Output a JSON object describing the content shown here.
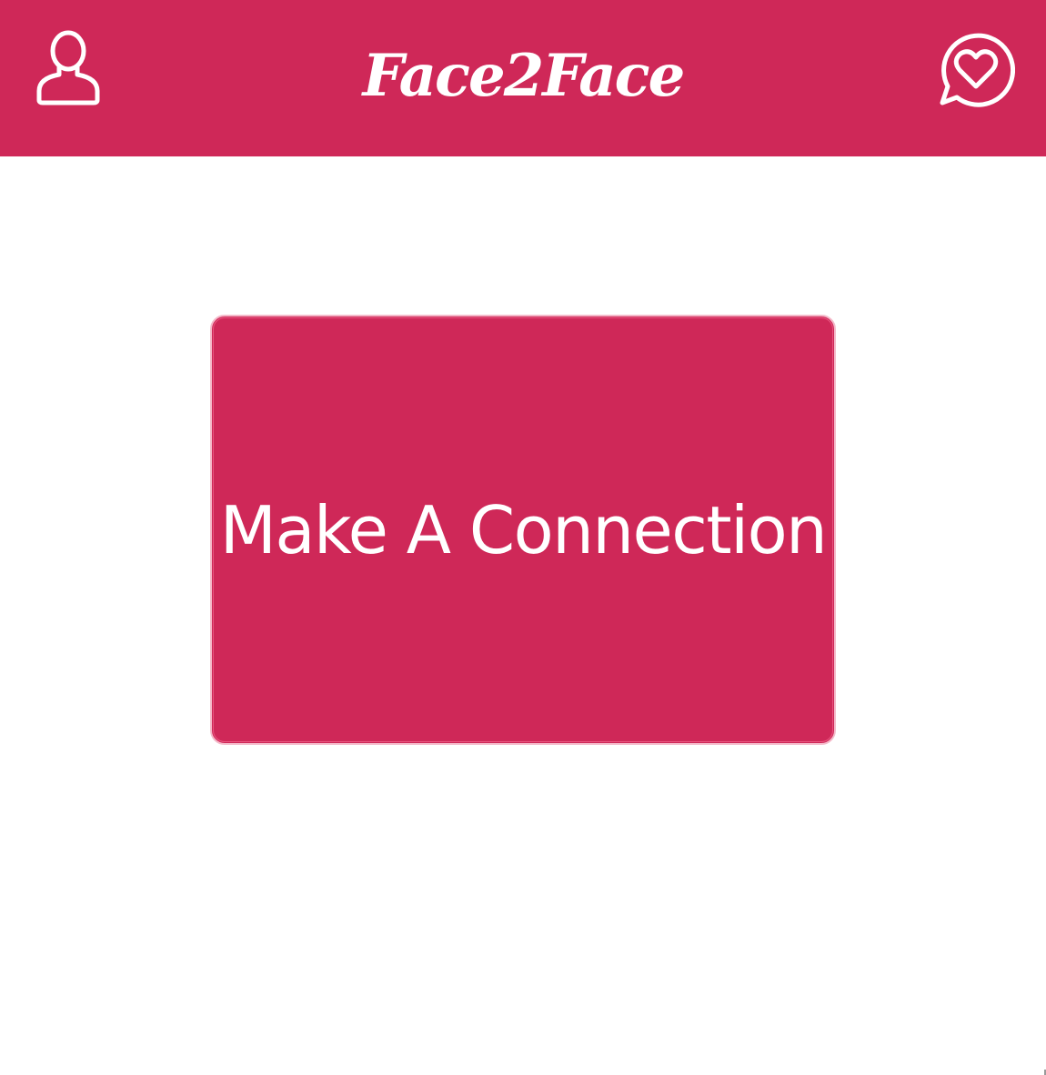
{
  "header": {
    "app_title": "Face2Face",
    "left_icon": "user-profile-icon",
    "right_icon": "heart-chat-icon",
    "background_color": "#cf2858"
  },
  "main": {
    "connect_button_label": "Make A Connection",
    "button_color": "#cf2858"
  }
}
